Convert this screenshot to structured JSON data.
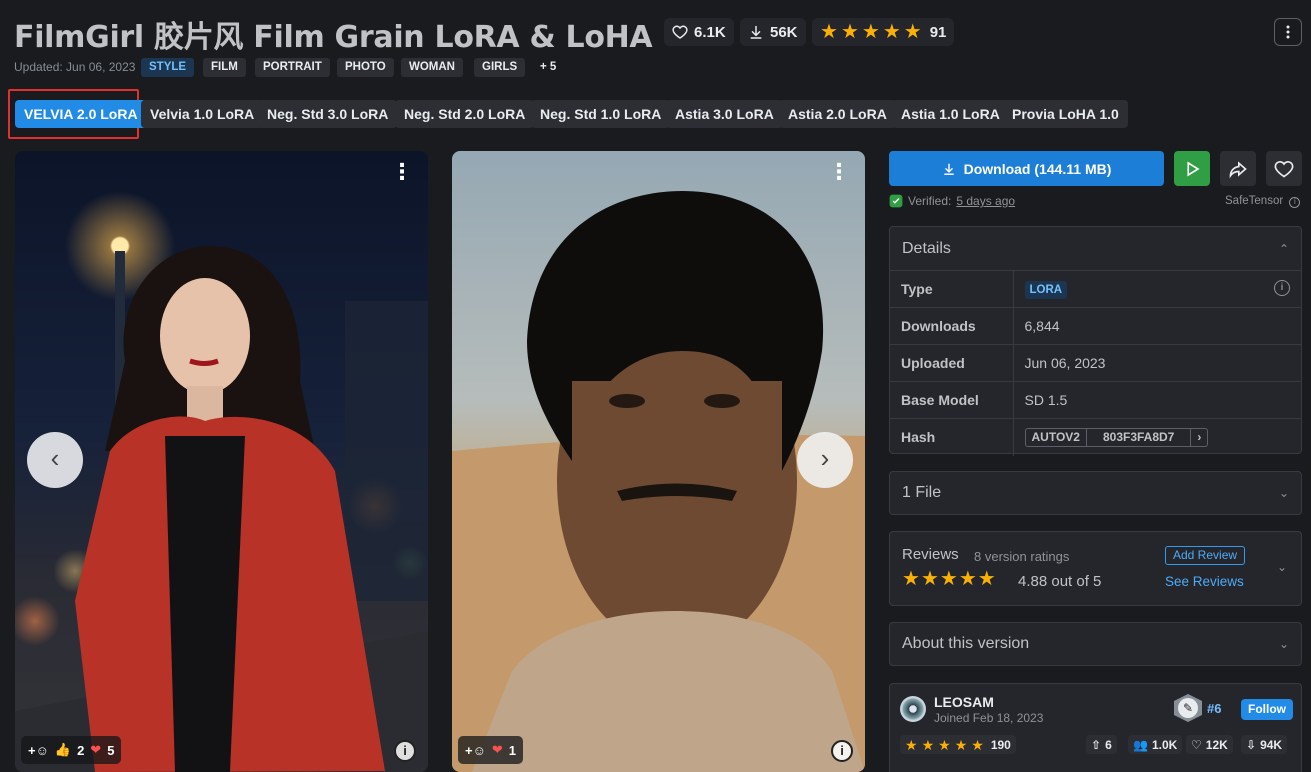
{
  "header": {
    "title": "FilmGirl 胶片风 Film Grain LoRA & LoHA",
    "likes": "6.1K",
    "downloads": "56K",
    "rating_count": "91",
    "menu_icon": "kebab-icon"
  },
  "meta": {
    "updated": "Updated: Jun 06, 2023",
    "category_tag": "STYLE",
    "tags": [
      "FILM",
      "PORTRAIT",
      "PHOTO",
      "WOMAN",
      "GIRLS"
    ],
    "more_tags": "+ 5"
  },
  "versions": [
    "VELVIA 2.0 LoRA",
    "Velvia 1.0 LoRA",
    "Neg. Std 3.0 LoRA",
    "Neg. Std 2.0 LoRA",
    "Neg. Std 1.0 LoRA",
    "Astia 3.0 LoRA",
    "Astia 2.0 LoRA",
    "Astia 1.0 LoRA",
    "Provia LoHA 1.0"
  ],
  "gallery": {
    "card1": {
      "thumbs": "2",
      "hearts": "5"
    },
    "card2": {
      "hearts": "1"
    }
  },
  "actions": {
    "download_label": "Download (144.11 MB)",
    "verified_label": "Verified:",
    "verified_time": "5 days ago",
    "safetensor": "SafeTensor"
  },
  "details": {
    "heading": "Details",
    "rows": [
      {
        "key": "Type",
        "value": "LORA"
      },
      {
        "key": "Downloads",
        "value": "6,844"
      },
      {
        "key": "Uploaded",
        "value": "Jun 06, 2023"
      },
      {
        "key": "Base Model",
        "value": "SD 1.5"
      },
      {
        "key": "Hash",
        "value": "803F3FA8D7",
        "algo": "AUTOV2"
      }
    ]
  },
  "files": {
    "heading": "1 File"
  },
  "reviews": {
    "heading": "Reviews",
    "count_text": "8 version ratings",
    "score_text": "4.88 out of 5",
    "add_review": "Add Review",
    "see_reviews": "See Reviews",
    "rating": 4.88
  },
  "about": {
    "heading": "About this version"
  },
  "creator": {
    "name": "LEOSAM",
    "joined": "Joined Feb 18, 2023",
    "rank": "#6",
    "follow": "Follow",
    "rating_count": "190",
    "uploads": "6",
    "followers": "1.0K",
    "favorites": "12K",
    "downloads": "94K"
  },
  "colors": {
    "accent": "#228be6",
    "highlight": "#e03131",
    "star": "#fab005",
    "run": "#2f9e44"
  }
}
